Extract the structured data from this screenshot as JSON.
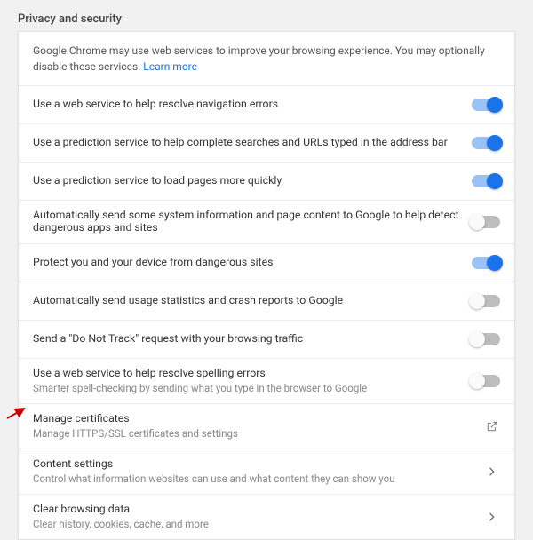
{
  "section_title": "Privacy and security",
  "intro": {
    "text": "Google Chrome may use web services to improve your browsing experience. You may optionally disable these services.",
    "learn_more": "Learn more"
  },
  "rows": [
    {
      "label": "Use a web service to help resolve navigation errors",
      "sub": "",
      "type": "toggle",
      "on": true
    },
    {
      "label": "Use a prediction service to help complete searches and URLs typed in the address bar",
      "sub": "",
      "type": "toggle",
      "on": true
    },
    {
      "label": "Use a prediction service to load pages more quickly",
      "sub": "",
      "type": "toggle",
      "on": true
    },
    {
      "label": "Automatically send some system information and page content to Google to help detect dangerous apps and sites",
      "sub": "",
      "type": "toggle",
      "on": false
    },
    {
      "label": "Protect you and your device from dangerous sites",
      "sub": "",
      "type": "toggle",
      "on": true
    },
    {
      "label": "Automatically send usage statistics and crash reports to Google",
      "sub": "",
      "type": "toggle",
      "on": false
    },
    {
      "label": "Send a \"Do Not Track\" request with your browsing traffic",
      "sub": "",
      "type": "toggle",
      "on": false
    },
    {
      "label": "Use a web service to help resolve spelling errors",
      "sub": "Smarter spell-checking by sending what you type in the browser to Google",
      "type": "toggle",
      "on": false
    },
    {
      "label": "Manage certificates",
      "sub": "Manage HTTPS/SSL certificates and settings",
      "type": "external"
    },
    {
      "label": "Content settings",
      "sub": "Control what information websites can use and what content they can show you",
      "type": "nav"
    },
    {
      "label": "Clear browsing data",
      "sub": "Clear history, cookies, cache, and more",
      "type": "nav"
    }
  ]
}
